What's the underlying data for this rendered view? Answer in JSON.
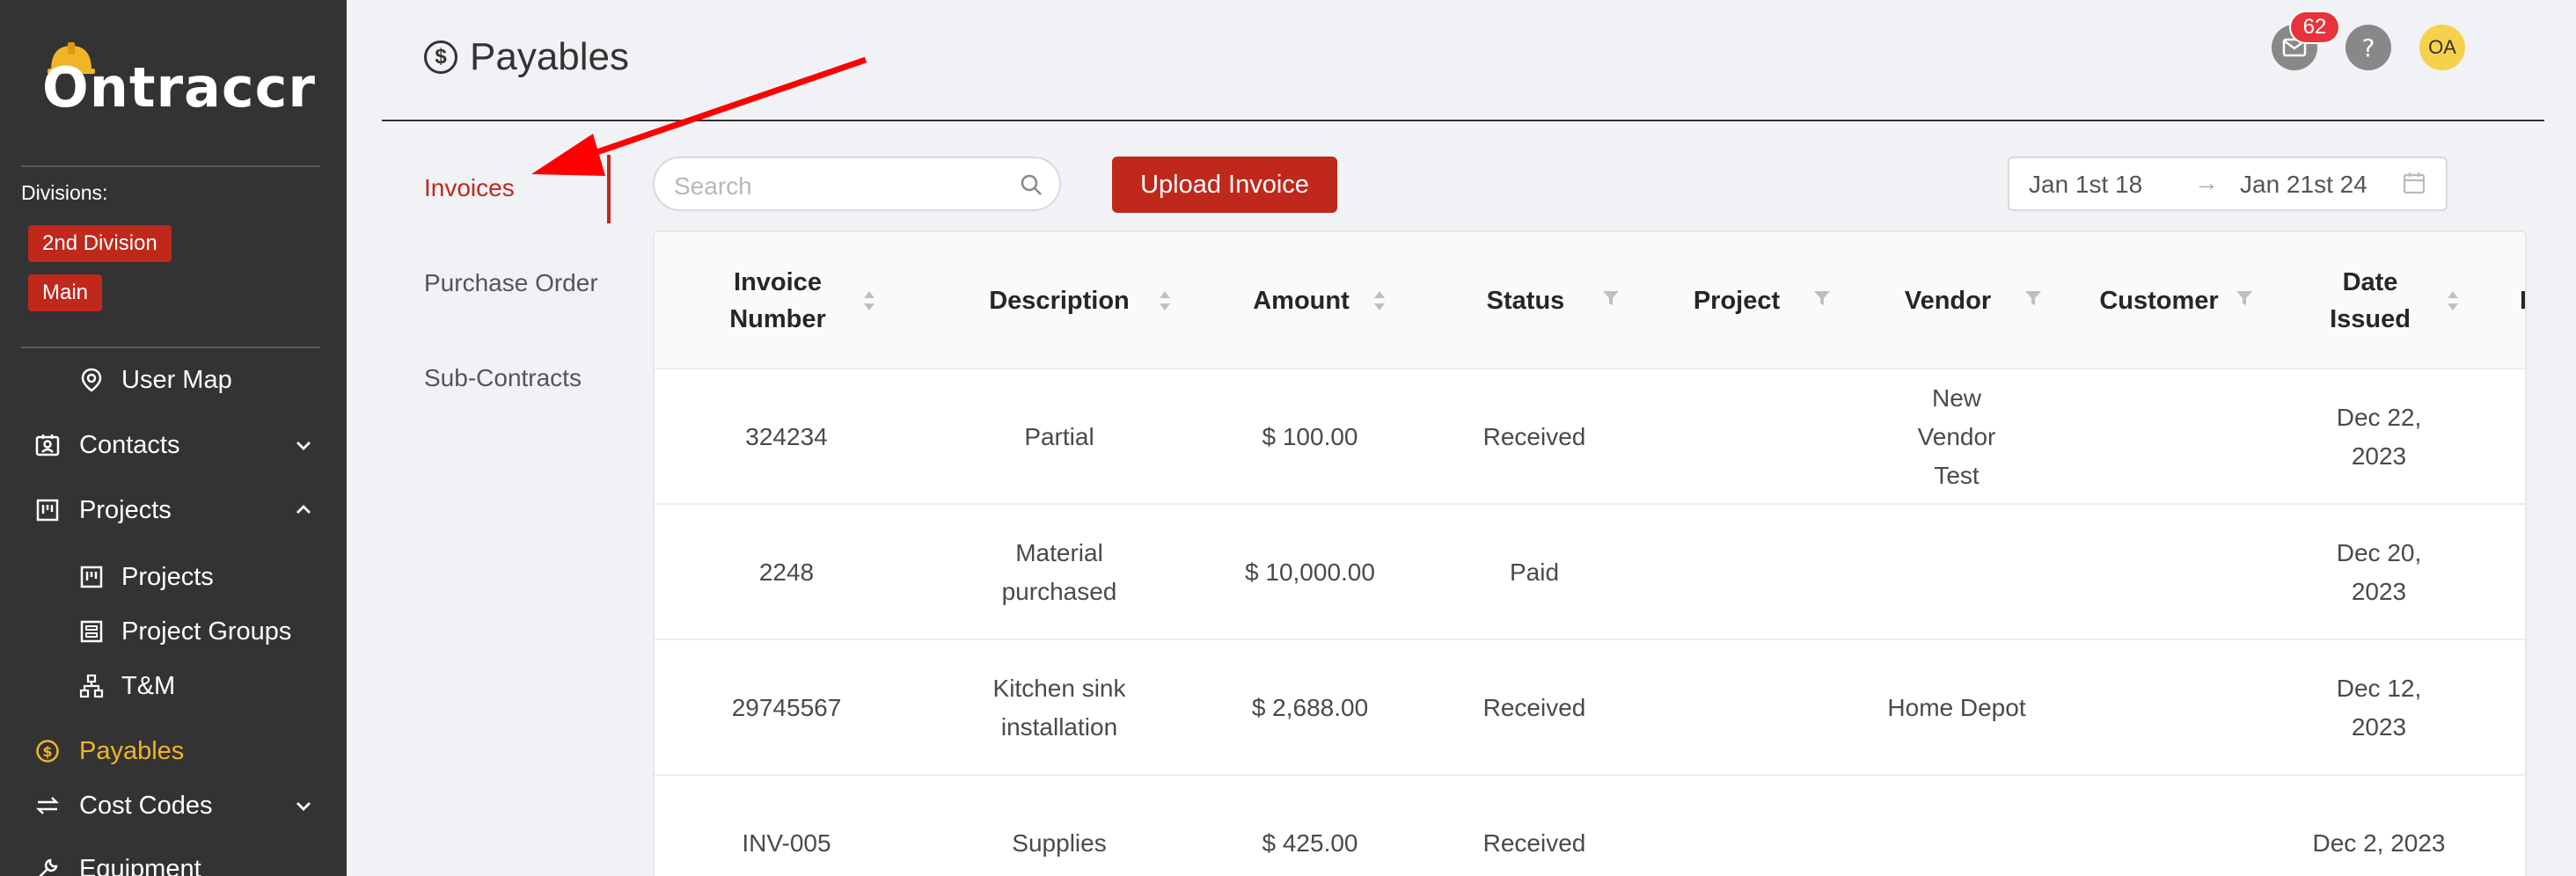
{
  "app": {
    "name": "Ontraccr"
  },
  "sidebar": {
    "divisions_label": "Divisions:",
    "divisions": [
      "2nd Division",
      "Main"
    ],
    "items": [
      {
        "label": "User Map",
        "icon": "location-pin-icon"
      },
      {
        "label": "Contacts",
        "icon": "contacts-icon"
      },
      {
        "label": "Projects",
        "icon": "projects-board-icon"
      },
      {
        "label": "Projects",
        "icon": "projects-board-icon"
      },
      {
        "label": "Project Groups",
        "icon": "project-groups-icon"
      },
      {
        "label": "T&M",
        "icon": "sitemap-icon"
      },
      {
        "label": "Payables",
        "icon": "dollar-circle-icon"
      },
      {
        "label": "Cost Codes",
        "icon": "swap-icon"
      },
      {
        "label": "Equipment",
        "icon": "wrench-icon"
      }
    ]
  },
  "header": {
    "title": "Payables",
    "notification_count": "62",
    "avatar_initials": "OA"
  },
  "subtabs": [
    "Invoices",
    "Purchase Order",
    "Sub-Contracts"
  ],
  "toolbar": {
    "search_placeholder": "Search",
    "upload_label": "Upload Invoice",
    "date_from": "Jan 1st 18",
    "date_arrow": "→",
    "date_to": "Jan 21st 24"
  },
  "table": {
    "columns": [
      "Invoice\nNumber",
      "Description",
      "Amount",
      "Status",
      "Project",
      "Vendor",
      "Customer",
      "Date\nIssued",
      "D"
    ],
    "rows": [
      {
        "number": "324234",
        "description": "Partial",
        "amount": "$ 100.00",
        "status": "Received",
        "project": "",
        "vendor": "New Vendor Test",
        "customer": "",
        "date": "Dec 22, 2023"
      },
      {
        "number": "2248",
        "description": "Material purchased",
        "amount": "$ 10,000.00",
        "status": "Paid",
        "project": "",
        "vendor": "",
        "customer": "",
        "date": "Dec 20, 2023"
      },
      {
        "number": "29745567",
        "description": "Kitchen sink installation",
        "amount": "$ 2,688.00",
        "status": "Received",
        "project": "",
        "vendor": "Home Depot",
        "customer": "",
        "date": "Dec 12, 2023"
      },
      {
        "number": "INV-005",
        "description": "Supplies",
        "amount": "$ 425.00",
        "status": "Received",
        "project": "",
        "vendor": "",
        "customer": "",
        "date": "Dec 2, 2023"
      }
    ]
  },
  "colors": {
    "sidebar_bg": "#333333",
    "accent_red": "#c0281c",
    "active_yellow": "#f0b429",
    "annotation_arrow": "#ff0000"
  }
}
